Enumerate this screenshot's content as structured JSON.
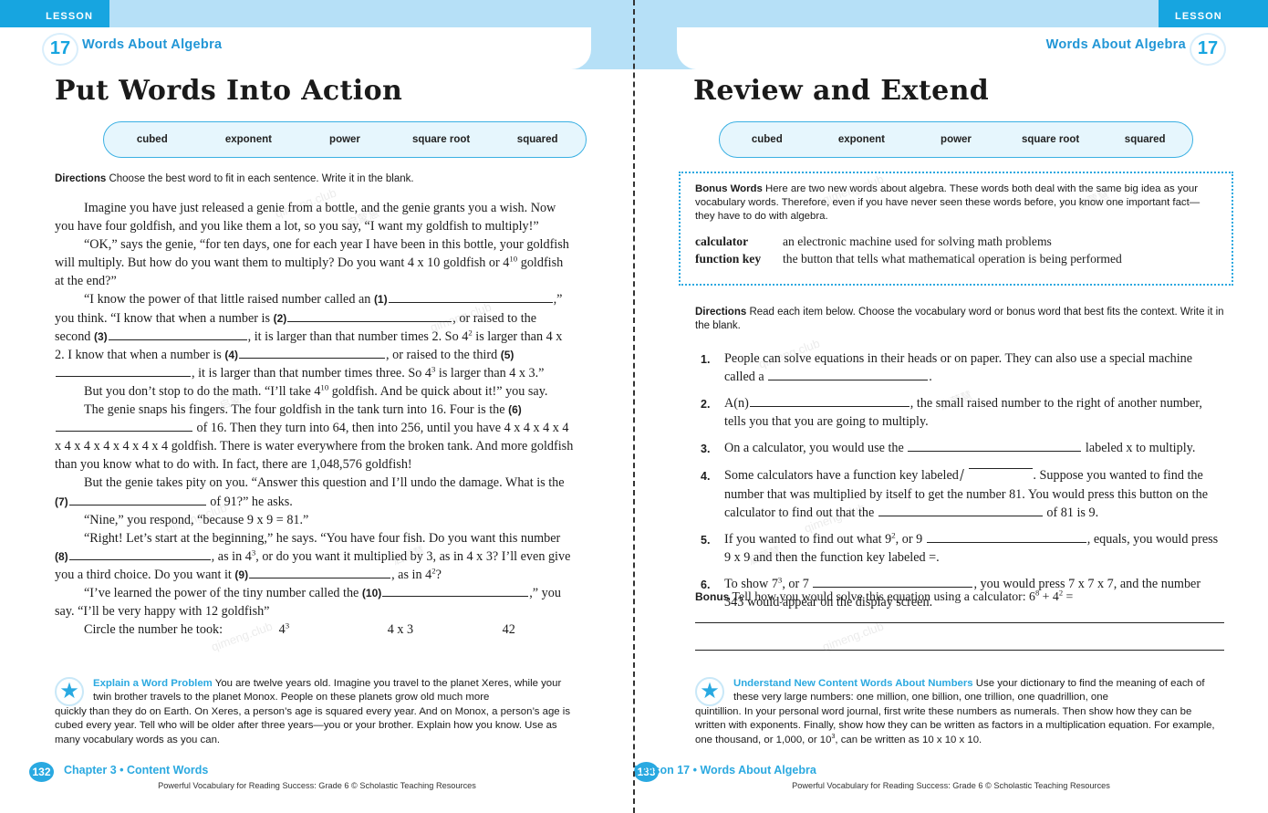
{
  "gutter": "dashed-fold-line",
  "colors": {
    "accent_blue": "#29a9e1",
    "band_blue": "#b6e0f7",
    "tab_blue": "#17a5e0",
    "pill_fill": "#e6f6fd",
    "pill_border": "#3ab0e3"
  },
  "watermark": {
    "text_a": "启蒙慧",
    "text_b": "qimeng.club"
  },
  "left_page": {
    "lesson_tab_label": "LESSON",
    "lesson_number": "17",
    "header_title": "Words About Algebra",
    "page_title": "Put Words Into Action",
    "vocab_words": [
      "cubed",
      "exponent",
      "power",
      "square root",
      "squared"
    ],
    "directions_label": "Directions",
    "directions_text": "Choose the best word to fit in each sentence. Write it in the blank.",
    "paragraphs": {
      "p1": "Imagine you have just released a genie from a bottle, and the genie grants you a wish. Now you have four goldfish, and you like them a lot, so you say, “I want my goldfish to multiply!”",
      "p2_a": "“OK,” says the genie, “for ten days, one for each year I have been in this bottle, your goldfish will multiply. But how do you want them to multiply? Do you want 4 x 10 goldfish or 4",
      "p2_sup": "10",
      "p2_b": " goldfish at the end?”",
      "p3_a": "“I know the power of that little raised number called an ",
      "p3_b": ",” you think. “I know that when a number is ",
      "p3_c": ", or raised to the second ",
      "p3_d": ", it is larger than that number times 2. So 4",
      "p3_sup1": "2",
      "p3_e": " is larger than 4 x 2. I know that when a number is ",
      "p3_f": ", or raised to the third ",
      "p3_g": ", it is larger than that number times three. So 4",
      "p3_sup2": "3",
      "p3_h": " is larger than 4 x 3.”",
      "p4_a": "But you don’t stop to do the math. “I’ll take 4",
      "p4_sup": "10",
      "p4_b": " goldfish. And be quick about it!” you say.",
      "p5_a": "The genie snaps his fingers. The four goldfish in the tank turn into 16. Four is the ",
      "p5_b": " of 16. Then they turn into 64, then into 256, until you have 4 x 4 x 4 x 4 x 4 x 4 x 4 x 4 x 4 x 4 goldfish. There is water everywhere from the broken tank. And more goldfish than you know what to do with. In fact, there are 1,048,576 goldfish!",
      "p6_a": "But the genie takes pity on you. “Answer this question and I’ll undo the damage. What is the ",
      "p6_b": " of 91?” he asks.",
      "p7": "“Nine,” you respond, “because 9 x 9 = 81.”",
      "p8_a": "“Right! Let’s start at the beginning,” he says. “You have four fish. Do you want this number ",
      "p8_b": ", as in 4",
      "p8_sup1": "3",
      "p8_c": ", or do you want it multiplied by 3, as in 4 x 3? I’ll even give you a third choice. Do you want it ",
      "p8_d": ", as in 4",
      "p8_sup2": "2",
      "p8_e": "?",
      "p9_a": "“I’ve learned the power of the tiny number called the ",
      "p9_b": ",” you say. “I’ll be very happy with 12 goldfish”",
      "circle_label": "Circle the number he took:",
      "circle_opt1": "4",
      "circle_opt1_sup": "3",
      "circle_opt2": "4 x 3",
      "circle_opt3": "42"
    },
    "blank_numbers": [
      "(1)",
      "(2)",
      "(3)",
      "(4)",
      "(5)",
      "(6)",
      "(7)",
      "(8)",
      "(9)",
      "(10)"
    ],
    "activity": {
      "icon": "star-icon",
      "heading": "Explain a Word Problem",
      "text_part1": "You are twelve years old. Imagine you travel to the planet Xeres, while your twin brother travels to the planet Monox. People on these planets grow old much more",
      "text_part2": "quickly than they do on Earth. On Xeres, a person’s age is squared every year. And on Monox, a person’s age is cubed every year. Tell who will be older after three years—you or your brother. Explain how you know. Use as many vocabulary words as you can."
    },
    "footer": {
      "page_number": "132",
      "title": "Chapter 3 • Content Words",
      "credit": "Powerful Vocabulary for Reading Success: Grade 6 © Scholastic Teaching Resources"
    }
  },
  "right_page": {
    "lesson_tab_label": "LESSON",
    "lesson_number": "17",
    "header_title": "Words About Algebra",
    "page_title": "Review and Extend",
    "vocab_words": [
      "cubed",
      "exponent",
      "power",
      "square root",
      "squared"
    ],
    "bonus_box": {
      "label": "Bonus Words",
      "intro": "Here are two new words about algebra. These words both deal with the same big idea as your vocabulary words. Therefore, even if you have never seen these words before, you know one important fact—they have to do with algebra.",
      "definitions": [
        {
          "term": "calculator",
          "definition": "an electronic machine used for solving math problems"
        },
        {
          "term": "function key",
          "definition": "the button that tells what mathematical operation is being performed"
        }
      ]
    },
    "directions_label": "Directions",
    "directions_text": "Read each item below. Choose the vocabulary word or bonus word that best fits the context. Write it in the blank.",
    "items": [
      {
        "num": "1.",
        "a": "People can solve equations in their heads or on paper. They can also use a special machine called a ",
        "b": "."
      },
      {
        "num": "2.",
        "a": "A(n)",
        "b": ", the small raised number to the right of another number, tells you that you are going to multiply."
      },
      {
        "num": "3.",
        "a": "On a calculator, you would use the ",
        "b": " labeled x to multiply."
      },
      {
        "num": "4.",
        "a": "Some calculators have a function key labeled ",
        "mid": ". Suppose you wanted to find the number that was multiplied by itself to get the number 81. You would press this button on the calculator to find out that the ",
        "b": " of 81 is 9."
      },
      {
        "num": "5.",
        "a": "If you wanted to find out what 9",
        "sup": "2",
        "a2": ", or 9 ",
        "b": ", equals, you would press 9 x 9 and then the function key labeled =."
      },
      {
        "num": "6.",
        "a": "To show 7",
        "sup": "3",
        "a2": ", or 7 ",
        "b": ", you would press 7 x 7 x 7, and the number 343 would appear on the display screen."
      }
    ],
    "bonus_prompt": {
      "label": "Bonus",
      "text_a": "Tell how you would solve this equation using a calculator: 6",
      "sup1": "8",
      "text_b": " + 4",
      "sup2": "2",
      "text_c": " ="
    },
    "activity": {
      "icon": "star-icon",
      "heading": "Understand New Content Words About Numbers",
      "text_part1": "Use your dictionary to find the meaning of each of these very large numbers: one million, one billion, one trillion, one quadrillion, one",
      "text_part2_a": "quintillion. In your personal word journal, first write these numbers as numerals. Then show how they can be written with exponents. Finally, show how they can be written as factors in a multiplication equation. For example, one thousand, or 1,000, or 10",
      "text_part2_sup": "3",
      "text_part2_b": ", can be written as 10 x 10 x 10."
    },
    "footer": {
      "page_number": "133",
      "title": "Lesson 17 • Words About Algebra",
      "credit": "Powerful Vocabulary for Reading Success: Grade 6 © Scholastic Teaching Resources"
    }
  }
}
